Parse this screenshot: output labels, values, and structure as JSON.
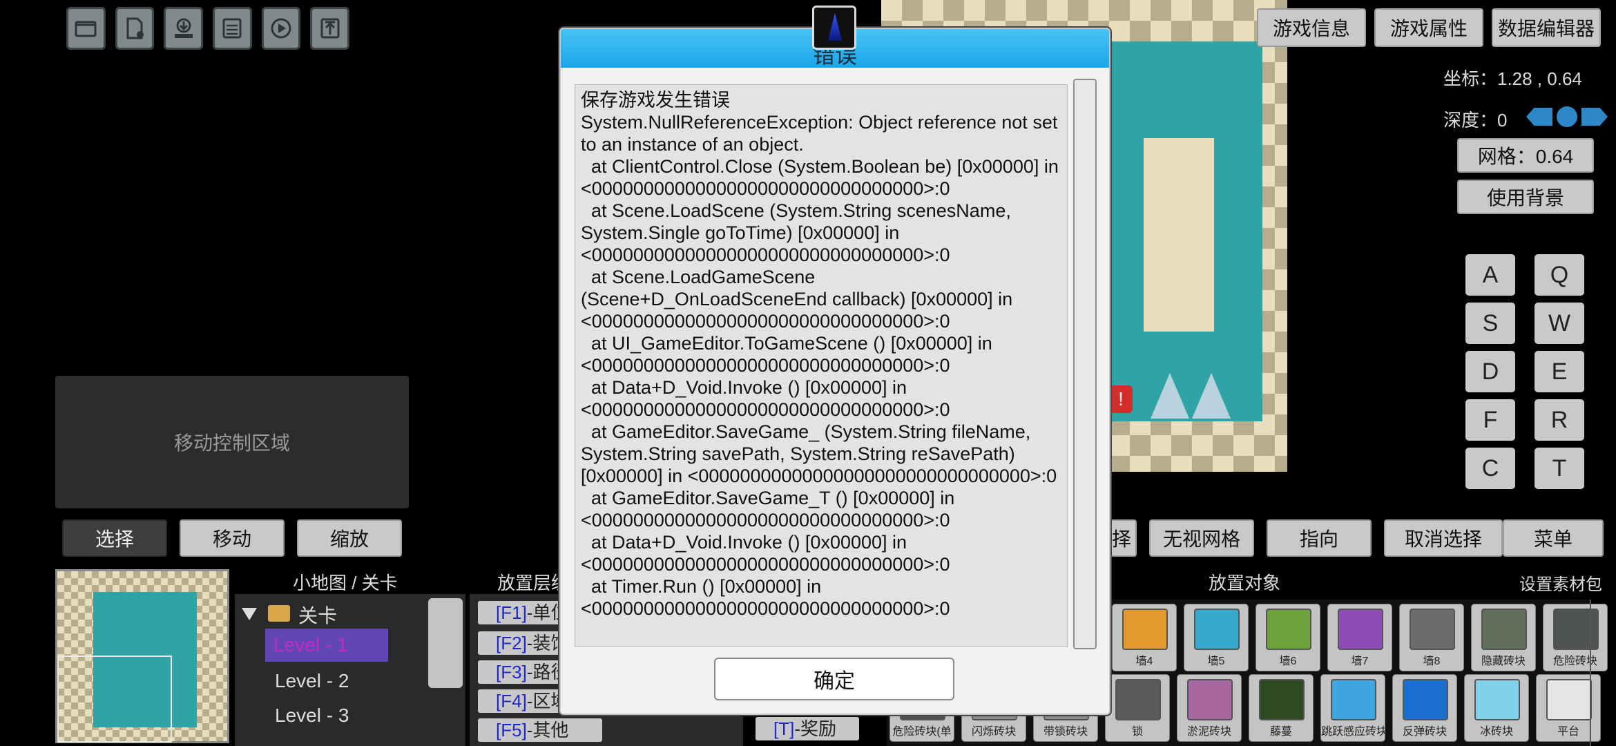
{
  "toolbar": {
    "icons": [
      "folder-open-icon",
      "new-file-icon",
      "import-icon",
      "save-icon",
      "play-icon",
      "upload-icon"
    ]
  },
  "top_right_buttons": [
    "游戏信息",
    "游戏属性",
    "数据编辑器"
  ],
  "coords_text": "坐标：1.28 , 0.64",
  "depth_text": "深度：0",
  "grid_button": "网格：0.64",
  "use_bg_button": "使用背景",
  "keys": [
    [
      "A",
      "Q"
    ],
    [
      "S",
      "W"
    ],
    [
      "D",
      "E"
    ],
    [
      "F",
      "R"
    ],
    [
      "C",
      "T"
    ]
  ],
  "move_area_label": "移动控制区域",
  "mode_buttons": [
    "选择",
    "移动",
    "缩放"
  ],
  "bottom_right_buttons": {
    "partial": "择",
    "ignore_grid": "无视网格",
    "point": "指向",
    "deselect": "取消选择",
    "menu": "菜单"
  },
  "section_titles": {
    "minimap": "小地图 / 关卡",
    "layers": "放置层级",
    "objects": "放置对象",
    "asset_pack": "设置素材包"
  },
  "level_tree": {
    "root": "关卡",
    "levels": [
      "Level - 1",
      "Level - 2",
      "Level - 3"
    ]
  },
  "layers": [
    {
      "key": "[F1]",
      "label": "-单位"
    },
    {
      "key": "[F2]",
      "label": "-装饰"
    },
    {
      "key": "[F3]",
      "label": "-路径"
    },
    {
      "key": "[F4]",
      "label": "-区域"
    },
    {
      "key": "[F5]",
      "label": "-其他"
    }
  ],
  "reward_item": {
    "key": "[T]",
    "label": "-奖励"
  },
  "objects_row1": [
    {
      "name": "墙4",
      "color": "#e29b2b"
    },
    {
      "name": "墙5",
      "color": "#34a9c9"
    },
    {
      "name": "墙6",
      "color": "#6da23a"
    },
    {
      "name": "墙7",
      "color": "#8d4cb5"
    },
    {
      "name": "墙8",
      "color": "#6b6b6b"
    },
    {
      "name": "隐藏砖块",
      "color": "#5f6f5a"
    },
    {
      "name": "危险砖块",
      "color": "#4c5350"
    }
  ],
  "objects_row2": [
    {
      "name": "危险砖块(单",
      "color": "#4c5350"
    },
    {
      "name": "闪烁砖块",
      "color": "#8e8e8e"
    },
    {
      "name": "带锁砖块",
      "color": "#8e8e8e"
    },
    {
      "name": "锁",
      "color": "#5a5a5a"
    },
    {
      "name": "淤泥砖块",
      "color": "#a9679f"
    },
    {
      "name": "藤蔓",
      "color": "#2e4a22"
    },
    {
      "name": "跳跃感应砖块",
      "color": "#3ea5e0"
    },
    {
      "name": "反弹砖块",
      "color": "#1a6fd1"
    },
    {
      "name": "冰砖块",
      "color": "#7fd2ea"
    },
    {
      "name": "平台",
      "color": "#e5e5e5"
    }
  ],
  "dialog": {
    "title": "错误",
    "message": "保存游戏发生错误\nSystem.NullReferenceException: Object reference not set to an instance of an object.\n  at ClientControl.Close (System.Boolean be) [0x00000] in <00000000000000000000000000000000>:0\n  at Scene.LoadScene (System.String scenesName, System.Single goToTime) [0x00000] in <00000000000000000000000000000000>:0\n  at Scene.LoadGameScene (Scene+D_OnLoadSceneEnd callback) [0x00000] in <00000000000000000000000000000000>:0\n  at UI_GameEditor.ToGameScene () [0x00000] in <00000000000000000000000000000000>:0\n  at Data+D_Void.Invoke () [0x00000] in <00000000000000000000000000000000>:0\n  at GameEditor.SaveGame_ (System.String fileName, System.String savePath, System.String reSavePath) [0x00000] in <00000000000000000000000000000000>:0\n  at GameEditor.SaveGame_T () [0x00000] in <00000000000000000000000000000000>:0\n  at Data+D_Void.Invoke () [0x00000] in <00000000000000000000000000000000>:0\n  at Timer.Run () [0x00000] in <00000000000000000000000000000000>:0",
    "ok_label": "确定"
  }
}
